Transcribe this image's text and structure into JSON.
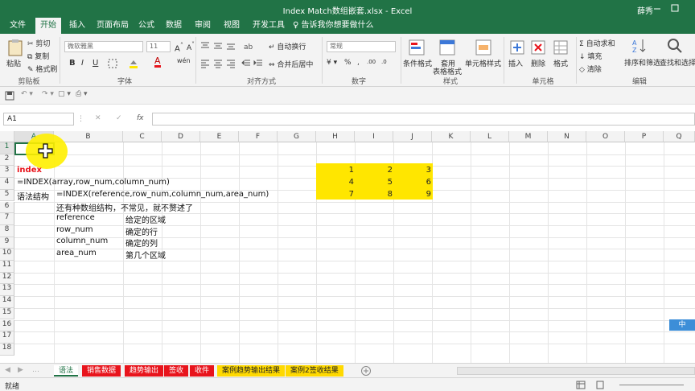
{
  "window": {
    "title": "Index Match数组嵌套.xlsx - Excel",
    "user": "薛秀"
  },
  "tabs": [
    "文件",
    "开始",
    "插入",
    "页面布局",
    "公式",
    "数据",
    "审阅",
    "视图",
    "开发工具"
  ],
  "tellme": "告诉我你想要做什么",
  "ribbon": {
    "paste": "粘贴",
    "cut": "剪切",
    "copy": "复制",
    "format_painter": "格式刷",
    "clipboard": "剪贴板",
    "font_name": "微软雅黑",
    "font_size": "11",
    "bold": "B",
    "italic": "I",
    "underline": "U",
    "font_group": "字体",
    "wrap": "自动换行",
    "merge": "合并后居中",
    "align_group": "对齐方式",
    "number_format": "常规",
    "number_group": "数字",
    "cond_format": "条件格式",
    "table_format_1": "套用",
    "table_format_2": "表格格式",
    "cell_style": "单元格样式",
    "style_group": "样式",
    "insert": "插入",
    "delete": "删除",
    "format": "格式",
    "cells_group": "单元格",
    "autosum": "自动求和",
    "fill": "填充",
    "clear": "清除",
    "sort": "排序和筛选",
    "find": "查找和选择",
    "edit_group": "编辑"
  },
  "namebox": "A1",
  "fx": "fx",
  "columns": [
    "A",
    "B",
    "C",
    "D",
    "E",
    "F",
    "G",
    "H",
    "I",
    "J",
    "K",
    "L",
    "M",
    "N",
    "O",
    "P",
    "Q"
  ],
  "rows": [
    "1",
    "2",
    "3",
    "4",
    "5",
    "6",
    "7",
    "8",
    "9",
    "10",
    "11",
    "12",
    "13",
    "14",
    "15",
    "16",
    "17",
    "18"
  ],
  "cells": {
    "a3": "index",
    "a4": "=INDEX(array,row_num,column_num)",
    "a5": "语法结构",
    "b5": "=INDEX(reference,row_num,column_num,area_num)",
    "b6": "还有种数组结构，不常见，就不赘述了",
    "b7": "reference",
    "c7": "给定的区域",
    "b8": "row_num",
    "c8": "确定的行",
    "b9": "column_num",
    "c9": "确定的列",
    "b10": "area_num",
    "c10": "第几个区域"
  },
  "matrix": [
    [
      "1",
      "2",
      "3"
    ],
    [
      "4",
      "5",
      "6"
    ],
    [
      "7",
      "8",
      "9"
    ]
  ],
  "sheet_tabs": [
    {
      "label": "语法",
      "color": "#ffffff",
      "text": "#217346"
    },
    {
      "label": "销售数据",
      "color": "#e8141c",
      "text": "#ffffff"
    },
    {
      "label": "趋势输出",
      "color": "#e8141c",
      "text": "#ffffff"
    },
    {
      "label": "签收",
      "color": "#e8141c",
      "text": "#ffffff"
    },
    {
      "label": "收件",
      "color": "#e8141c",
      "text": "#ffffff"
    },
    {
      "label": "案例趋势输出结果",
      "color": "#ffd900",
      "text": "#222222"
    },
    {
      "label": "案例2签收结果",
      "color": "#ffd900",
      "text": "#222222"
    }
  ],
  "status": "就绪",
  "ime": "中"
}
